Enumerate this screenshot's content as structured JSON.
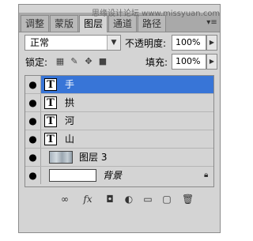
{
  "watermark": "思缘设计论坛 www.missyuan.com",
  "tabs": [
    {
      "label": "调整"
    },
    {
      "label": "蒙版"
    },
    {
      "label": "图层"
    },
    {
      "label": "通道"
    },
    {
      "label": "路径"
    }
  ],
  "blend_mode": "正常",
  "opacity_label": "不透明度:",
  "opacity_value": "100%",
  "lock_label": "锁定:",
  "fill_label": "填充:",
  "fill_value": "100%",
  "layers": [
    {
      "name": "手",
      "kind": "text",
      "selected": true
    },
    {
      "name": "拱",
      "kind": "text"
    },
    {
      "name": "河",
      "kind": "text"
    },
    {
      "name": "山",
      "kind": "text"
    },
    {
      "name": "图层 3",
      "kind": "image"
    },
    {
      "name": "背景",
      "kind": "background",
      "locked": true
    }
  ],
  "text_thumb_glyph": "T",
  "icons": {
    "eye": "eye-icon",
    "menu": "panel-menu-icon",
    "link": "link-layers-icon",
    "fx": "layer-style-icon",
    "mask": "add-mask-icon",
    "adjust": "adjustment-layer-icon",
    "group": "new-group-icon",
    "new": "new-layer-icon",
    "trash": "delete-layer-icon"
  },
  "colors": {
    "selected": "#3875d7",
    "panel": "#d4d4d4"
  }
}
